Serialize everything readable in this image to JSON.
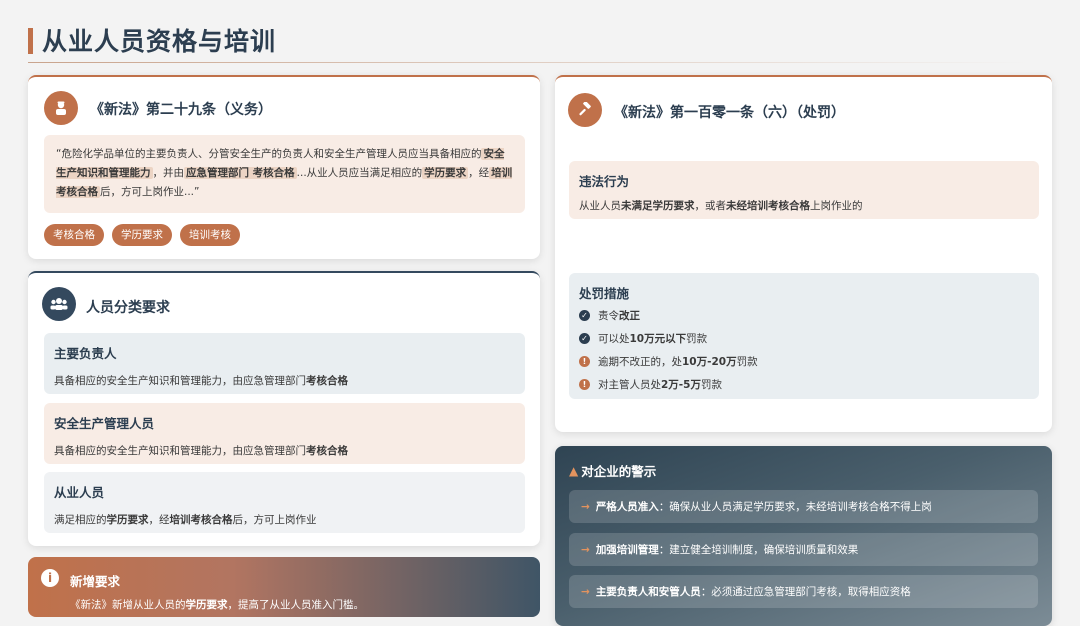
{
  "page": {
    "title": "从业人员资格与培训"
  },
  "article29": {
    "icon": "worker-icon",
    "heading": "《新法》第二十九条（义务）",
    "quote": {
      "p1": "“危险化学品单位的主要负责人、分管安全生产的负责人和安全生产管理人员应当具备相应的",
      "h1": "安全生产知识和管理能力",
      "p2": "，并由",
      "h2": "应急管理部门 考核合格",
      "p3": "...从业人员应当满足相应的",
      "h3": "学历要求",
      "p4": "，经",
      "h4": "培训考核合格",
      "p5": "后，方可上岗作业...”"
    },
    "tags": [
      "考核合格",
      "学历要求",
      "培训考核"
    ]
  },
  "categories": {
    "icon": "people-icon",
    "heading": "人员分类要求",
    "items": [
      {
        "title": "主要负责人",
        "desc_plain": "具备相应的安全生产知识和管理能力，由应急管理部门",
        "desc_bold": "考核合格",
        "desc_plain2": "",
        "desc_bold2": "",
        "desc_plain3": ""
      },
      {
        "title": "安全生产管理人员",
        "desc_plain": "具备相应的安全生产知识和管理能力，由应急管理部门",
        "desc_bold": "考核合格",
        "desc_plain2": "",
        "desc_bold2": "",
        "desc_plain3": ""
      },
      {
        "title": "从业人员",
        "desc_plain": "满足相应的",
        "desc_bold": "学历要求",
        "desc_plain2": "，经",
        "desc_bold2": "培训考核合格",
        "desc_plain3": "后，方可上岗作业"
      }
    ]
  },
  "new_requirement": {
    "icon": "info-icon",
    "title": "新增要求",
    "text_plain": "《新法》新增从业人员的",
    "text_bold": "学历要求",
    "text_plain2": "，提高了从业人员准入门槛。"
  },
  "article101": {
    "icon": "gavel-icon",
    "heading": "《新法》第一百零一条（六）（处罚）",
    "violation": {
      "title": "违法行为",
      "p1": "从业人员",
      "b1": "未满足学历要求",
      "p2": "，或者",
      "b2": "未经培训考核合格",
      "p3": "上岗作业的"
    },
    "penalties": {
      "title": "处罚措施",
      "items": [
        {
          "icon": "check-circle-icon",
          "prefix": "责令",
          "bold": "改正",
          "suffix": ""
        },
        {
          "icon": "check-circle-icon",
          "prefix": "可以处",
          "bold": "10万元以下",
          "suffix": "罚款"
        },
        {
          "icon": "alert-circle-icon",
          "prefix": "逾期不改正的，处",
          "bold": "10万-20万",
          "suffix": "罚款"
        },
        {
          "icon": "alert-circle-icon",
          "prefix": "对主管人员处",
          "bold": "2万-5万",
          "suffix": "罚款"
        }
      ]
    }
  },
  "warnings": {
    "icon": "warning-triangle-icon",
    "title": "对企业的警示",
    "items": [
      {
        "bold": "严格人员准入",
        "text": "：确保从业人员满足学历要求，未经培训考核合格不得上岗"
      },
      {
        "bold": "加强培训管理",
        "text": "：建立健全培训制度，确保培训质量和效果"
      },
      {
        "bold": "主要负责人和安管人员",
        "text": "：必须通过应急管理部门考核，取得相应资格"
      }
    ]
  }
}
